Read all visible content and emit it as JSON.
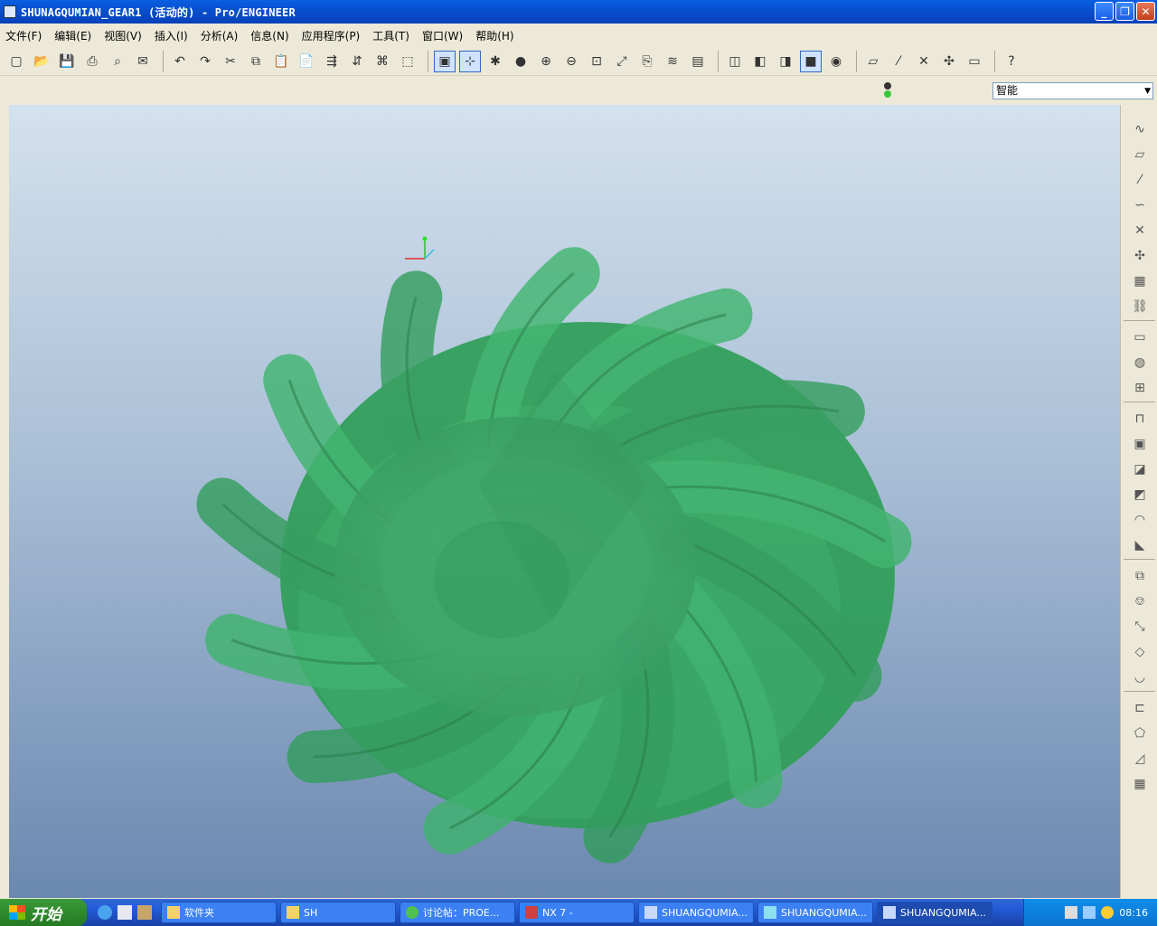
{
  "window": {
    "title": "SHUNAGQUMIAN_GEAR1 (活动的) - Pro/ENGINEER",
    "controls": {
      "minimize": "_",
      "restore": "❐",
      "close": "✕"
    }
  },
  "menu": [
    "文件(F)",
    "编辑(E)",
    "视图(V)",
    "插入(I)",
    "分析(A)",
    "信息(N)",
    "应用程序(P)",
    "工具(T)",
    "窗口(W)",
    "帮助(H)"
  ],
  "toolbar": {
    "groups": [
      [
        "new-icon",
        "open-icon",
        "save-icon",
        "print-icon",
        "print-preview-icon",
        "email-icon"
      ],
      [
        "undo-icon",
        "redo-icon",
        "cut-icon",
        "copy-icon",
        "paste-icon",
        "paste-special-icon",
        "regenerate-icon",
        "regen-manager-icon",
        "find-icon",
        "select-box-icon"
      ],
      [
        "repaint-icon",
        "spin-center-icon",
        "orient-icon",
        "appearance-icon",
        "zoom-in-icon",
        "zoom-out-icon",
        "refit-icon",
        "reorient-icon",
        "saved-views-icon",
        "layers-icon",
        "view-manager-icon"
      ],
      [
        "wireframe-icon",
        "hidden-line-icon",
        "no-hidden-icon",
        "shading-icon",
        "model-tree-icon"
      ],
      [
        "datum-plane-icon",
        "datum-axis-icon",
        "datum-point-icon",
        "csys-icon",
        "annotation-icon"
      ],
      [
        "help-icon"
      ]
    ],
    "glyphs": {
      "new-icon": "▢",
      "open-icon": "📂",
      "save-icon": "💾",
      "print-icon": "⎙",
      "print-preview-icon": "⌕",
      "email-icon": "✉",
      "undo-icon": "↶",
      "redo-icon": "↷",
      "cut-icon": "✂",
      "copy-icon": "⧉",
      "paste-icon": "📋",
      "paste-special-icon": "📄",
      "regenerate-icon": "⇶",
      "regen-manager-icon": "⇵",
      "find-icon": "⌘",
      "select-box-icon": "⬚",
      "repaint-icon": "▣",
      "spin-center-icon": "⊹",
      "orient-icon": "✱",
      "appearance-icon": "●",
      "zoom-in-icon": "⊕",
      "zoom-out-icon": "⊖",
      "refit-icon": "⊡",
      "reorient-icon": "⤢",
      "saved-views-icon": "⎘",
      "layers-icon": "≋",
      "view-manager-icon": "▤",
      "wireframe-icon": "◫",
      "hidden-line-icon": "◧",
      "no-hidden-icon": "◨",
      "shading-icon": "■",
      "model-tree-icon": "◉",
      "datum-plane-icon": "▱",
      "datum-axis-icon": "⁄",
      "datum-point-icon": "✕",
      "csys-icon": "✣",
      "annotation-icon": "▭",
      "help-icon": "?"
    }
  },
  "filter": {
    "value": "智能"
  },
  "sidebar": {
    "icons": [
      "sketch-icon",
      "plane-icon",
      "axis-icon",
      "curve-icon",
      "point-icon",
      "csys-datum-icon",
      "analysis-icon",
      "link-icon",
      "note-icon",
      "view-icon",
      "table-icon",
      "hole-icon",
      "shell-icon",
      "rib-icon",
      "draft-icon",
      "round-icon",
      "chamfer-icon",
      "pattern-icon",
      "mirror-icon",
      "trim-icon",
      "offset-icon",
      "thicken-icon",
      "merge-icon",
      "intersect-icon",
      "solidify-icon",
      "grid-icon"
    ],
    "glyphs": {
      "sketch-icon": "∿",
      "plane-icon": "▱",
      "axis-icon": "⁄",
      "curve-icon": "∽",
      "point-icon": "✕",
      "csys-datum-icon": "✣",
      "analysis-icon": "▦",
      "link-icon": "⛓",
      "note-icon": "▭",
      "view-icon": "◍",
      "table-icon": "⊞",
      "hole-icon": "⊓",
      "shell-icon": "▣",
      "rib-icon": "◪",
      "draft-icon": "◩",
      "round-icon": "◠",
      "chamfer-icon": "◣",
      "pattern-icon": "⧉",
      "mirror-icon": "⎊",
      "trim-icon": "⤡",
      "offset-icon": "◇",
      "thicken-icon": "◡",
      "merge-icon": "⊏",
      "intersect-icon": "⬠",
      "solidify-icon": "◿",
      "grid-icon": "▦"
    }
  },
  "model": {
    "color": "#3fae68",
    "name": "SHUNAGQUMIAN_GEAR1"
  },
  "taskbar": {
    "start_label": "开始",
    "tasks": [
      "软件夹",
      "SH",
      "讨论帖：PROE...",
      "NX 7 -",
      "SHUANGQUMIA...",
      "SHUANGQUMIA...",
      "SHUANGQUMIA..."
    ],
    "clock": "08:16"
  }
}
